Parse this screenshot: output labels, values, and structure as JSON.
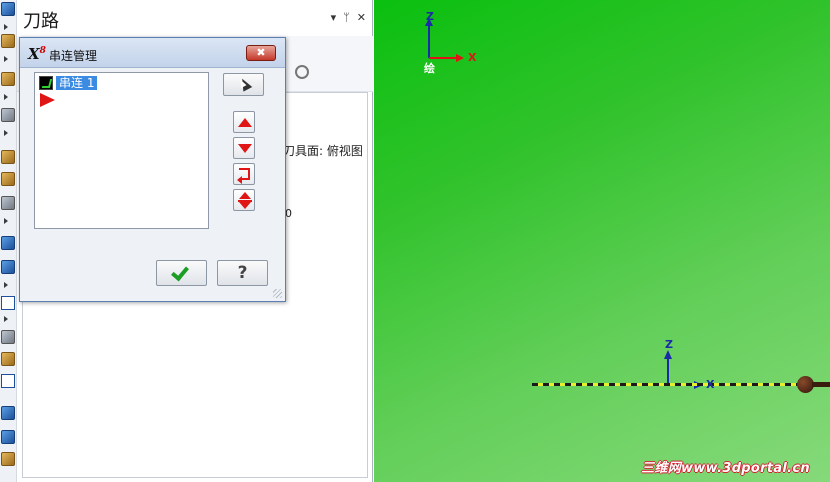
{
  "panel": {
    "title": "刀路",
    "controls": {
      "menu": "▾",
      "pin": "ᛘ",
      "close": "✕"
    },
    "plane_text": "刀具面: 俯视图",
    "stray_value": "0"
  },
  "dialog": {
    "logo": "X",
    "title": "串连管理",
    "close_label": "✖",
    "chains": [
      {
        "label": "串连 1",
        "selected": true
      }
    ],
    "buttons": {
      "ok": "✔",
      "help": "?"
    }
  },
  "viewport": {
    "top_axes": {
      "z": "Z",
      "x": "X",
      "label": "绘"
    },
    "origin_axes": {
      "z": "Z",
      "x": "X"
    },
    "watermark": "三维网www.3dportal.cn"
  },
  "colors": {
    "background_top": "#0ac00f",
    "background_bottom": "#86d97a",
    "chain_dash": "#e7f02a",
    "axis_blue": "#1a2aa8",
    "axis_red": "#e01515"
  }
}
